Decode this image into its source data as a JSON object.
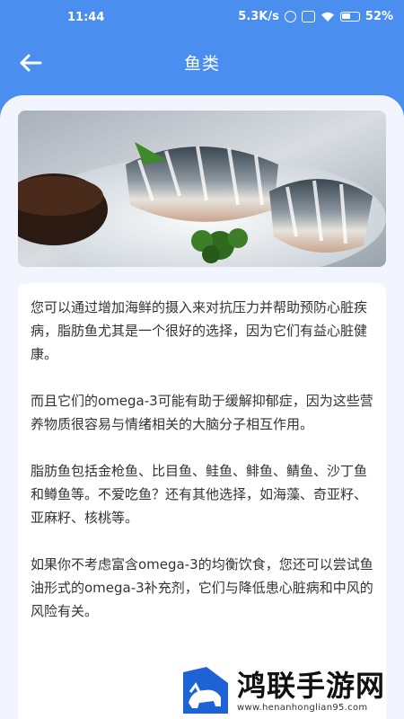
{
  "status_bar": {
    "time": "11:44",
    "network_speed": "5.3K/s",
    "battery_percent": "52%",
    "icons": [
      "alarm-icon",
      "sim-off-icon",
      "battery-icon",
      "wifi-icon"
    ]
  },
  "header": {
    "title": "鱼类",
    "back_icon": "arrow-left-icon"
  },
  "hero": {
    "image_subject": "mackerel sushi on ice with parsley and soy sauce"
  },
  "article": {
    "paragraphs": [
      "您可以通过增加海鲜的摄入来对抗压力并帮助预防心脏疾病，脂肪鱼尤其是一个很好的选择，因为它们有益心脏健康。",
      "而且它们的omega-3可能有助于缓解抑郁症，因为这些营养物质很容易与情绪相关的大脑分子相互作用。",
      "脂肪鱼包括金枪鱼、比目鱼、鲑鱼、鲱鱼、鲭鱼、沙丁鱼和鳟鱼等。不爱吃鱼？还有其他选择，如海藻、奇亚籽、亚麻籽、核桃等。",
      "如果你不考虑富含omega-3的均衡饮食，您还可以尝试鱼油形式的omega-3补充剂，它们与降低患心脏病和中风的风险有关。"
    ]
  },
  "watermark": {
    "title": "鸿联手游网",
    "url": "www.henanhonglian95.com"
  },
  "colors": {
    "header_bg": "#4a8ef0",
    "content_bg": "#f2f5fd",
    "text": "#333333"
  }
}
